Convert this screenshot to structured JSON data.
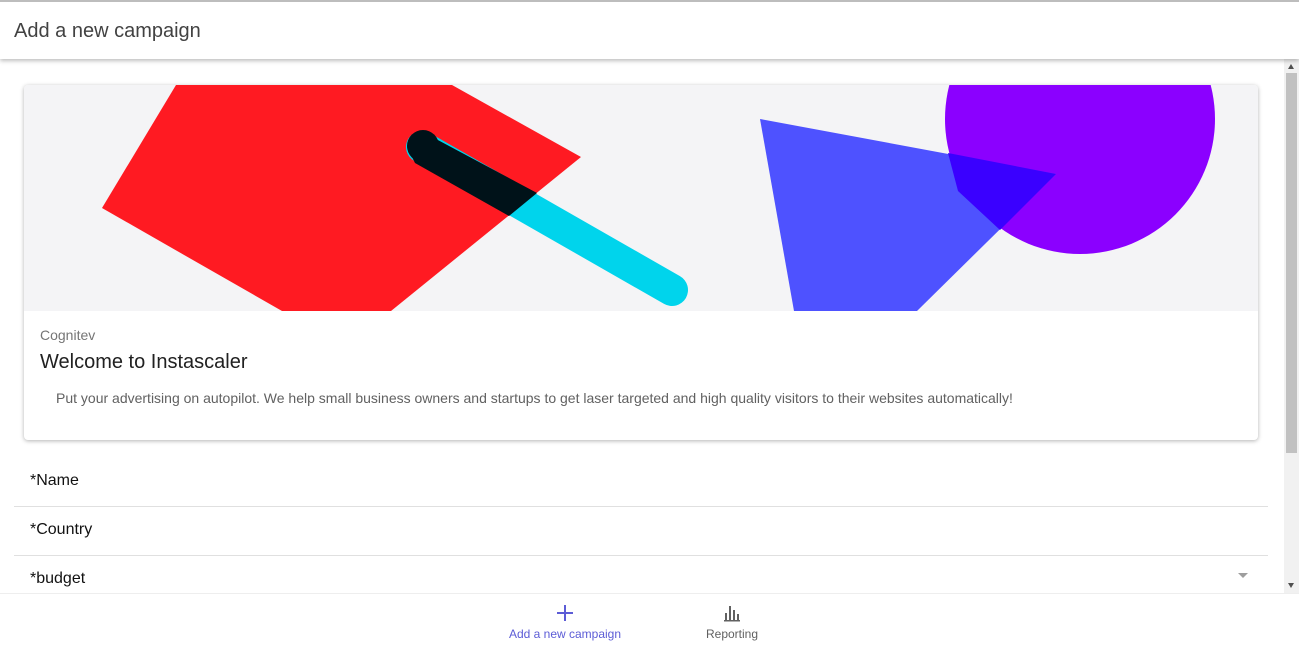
{
  "header": {
    "title": "Add a new campaign"
  },
  "card": {
    "company": "Cognitev",
    "title": "Welcome to Instascaler",
    "description": "Put your advertising on autopilot. We help small business owners and startups to get laser targeted and high quality visitors to their websites automatically!"
  },
  "form": {
    "name_label": "*Name",
    "country_label": "*Country",
    "budget_label": "*budget"
  },
  "bottom_nav": {
    "add_label": "Add a new campaign",
    "add_icon": "plus-icon",
    "reporting_label": "Reporting",
    "reporting_icon": "bar-chart-icon",
    "active_color": "#5c5cd6",
    "inactive_color": "#616161"
  },
  "hero_colors": {
    "background": "#f4f4f6",
    "red": "#ff1a22",
    "cyan": "#00d4ec",
    "black": "#001219",
    "blue": "#4e52ff",
    "purple": "#8b00ff"
  }
}
